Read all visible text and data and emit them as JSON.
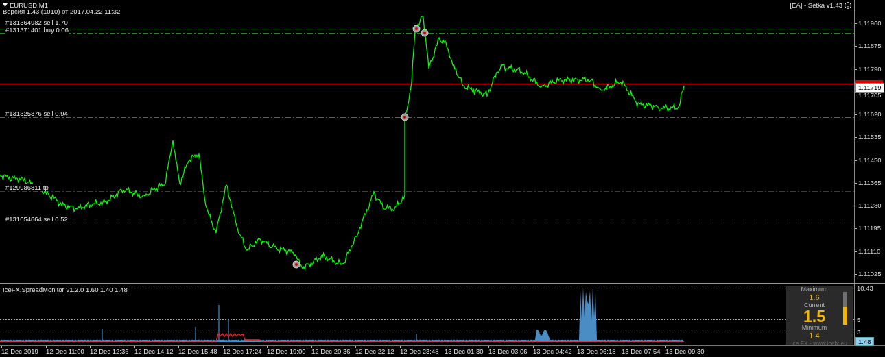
{
  "chart": {
    "symbol": "EURUSD,M1",
    "version_text": "Версия 1.43 (1010) от 2017.04.22 11:32",
    "expert": "[EA] - Setka v1.43",
    "order_lines": [
      {
        "label": "#131364982 sell 1.70",
        "kind": "sell"
      },
      {
        "label": "#131371401 buy 0.06",
        "kind": "buy"
      },
      {
        "label": "#131325376 sell 0.94",
        "kind": "sell"
      },
      {
        "label": "#129986811 tp",
        "kind": "tp"
      },
      {
        "label": "#131054664 sell 0.52",
        "kind": "sell"
      }
    ],
    "price_axis": {
      "ticks": [
        "1.11960",
        "1.11875",
        "1.11790",
        "1.11705",
        "1.11620",
        "1.11535",
        "1.11450",
        "1.11365",
        "1.11280",
        "1.11195",
        "1.11110",
        "1.11025"
      ],
      "current_price": "1.11719"
    }
  },
  "indicator": {
    "title": "IceFX.SpreadMonitor v1.2.0 1.60 1.40 1.48",
    "axis_labels": [
      "10.43",
      "5",
      "3"
    ],
    "current_value": "1.48",
    "panel": {
      "maximum_label": "Maximum",
      "maximum": "1.6",
      "current_label": "Current",
      "current": "1.5",
      "minimum_label": "Minimum",
      "minimum": "1.4",
      "level": 0.55,
      "footer": "Ice FX - www.icefx.eu"
    }
  },
  "time_axis": [
    "12 Dec 2019",
    "12 Dec 11:00",
    "12 Dec 12:36",
    "12 Dec 14:12",
    "12 Dec 15:48",
    "12 Dec 17:24",
    "12 Dec 19:00",
    "12 Dec 20:36",
    "12 Dec 22:12",
    "12 Dec 23:48",
    "13 Dec 01:30",
    "13 Dec 03:06",
    "13 Dec 04:42",
    "13 Dec 06:18",
    "13 Dec 07:54",
    "13 Dec 09:30"
  ]
}
